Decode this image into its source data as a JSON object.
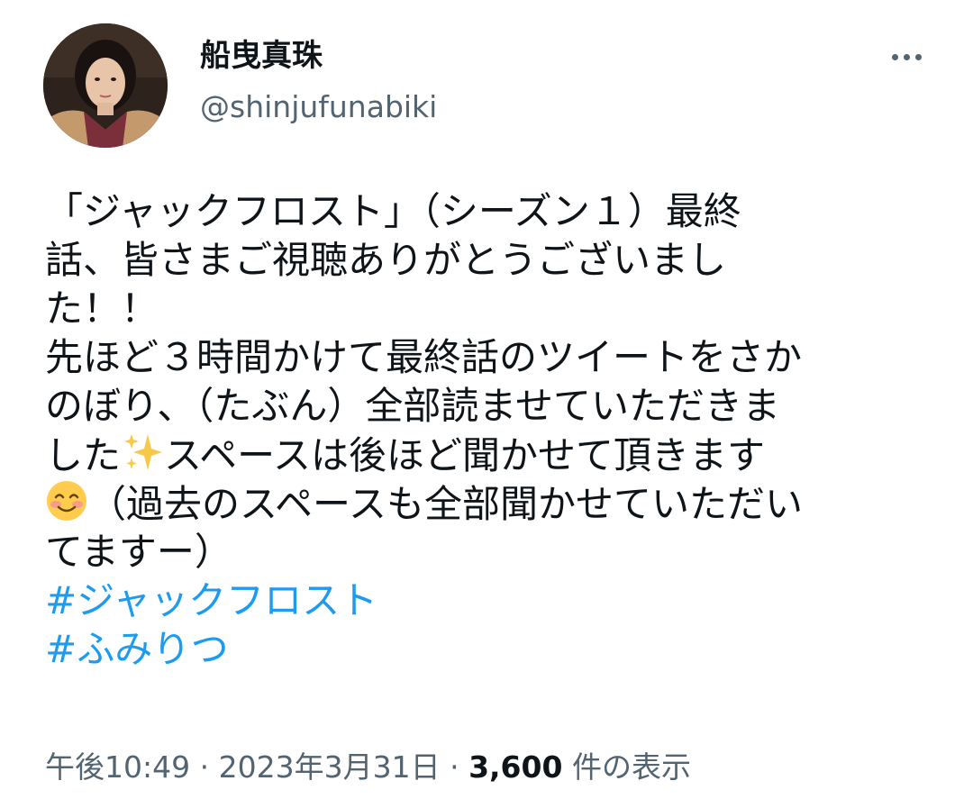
{
  "author": {
    "display_name": "船曳真珠",
    "handle": "@shinjufunabiki",
    "avatar_icon": "profile-photo"
  },
  "header": {
    "more_icon": "more-horizontal-icon"
  },
  "tweet": {
    "lines": [
      "「ジャックフロスト」（シーズン１）最終",
      "話、皆さまご視聴ありがとうございまし",
      "た！！",
      "先ほど３時間かけて最終話のツイートをさか",
      "のぼり、（たぶん）全部読ませていただきま"
    ],
    "line6_before": "した",
    "sparkles_emoji_icon": "sparkles-emoji-icon",
    "line6_after": "スペースは後ほど聞かせて頂きます",
    "smiling_emoji_icon": "smiling-face-emoji-icon",
    "line7_after": "（過去のスペースも全部聞かせていただい",
    "line8": "てますー）",
    "hashtags": [
      "#ジャックフロスト",
      "#ふみりつ"
    ]
  },
  "meta": {
    "time": "午後10:49",
    "separator": " · ",
    "date": "2023年3月31日",
    "views_count": "3,600",
    "views_label": " 件の表示"
  },
  "colors": {
    "link": "#1d9bf0",
    "secondary_text": "#536471",
    "primary_text": "#0f1419"
  }
}
